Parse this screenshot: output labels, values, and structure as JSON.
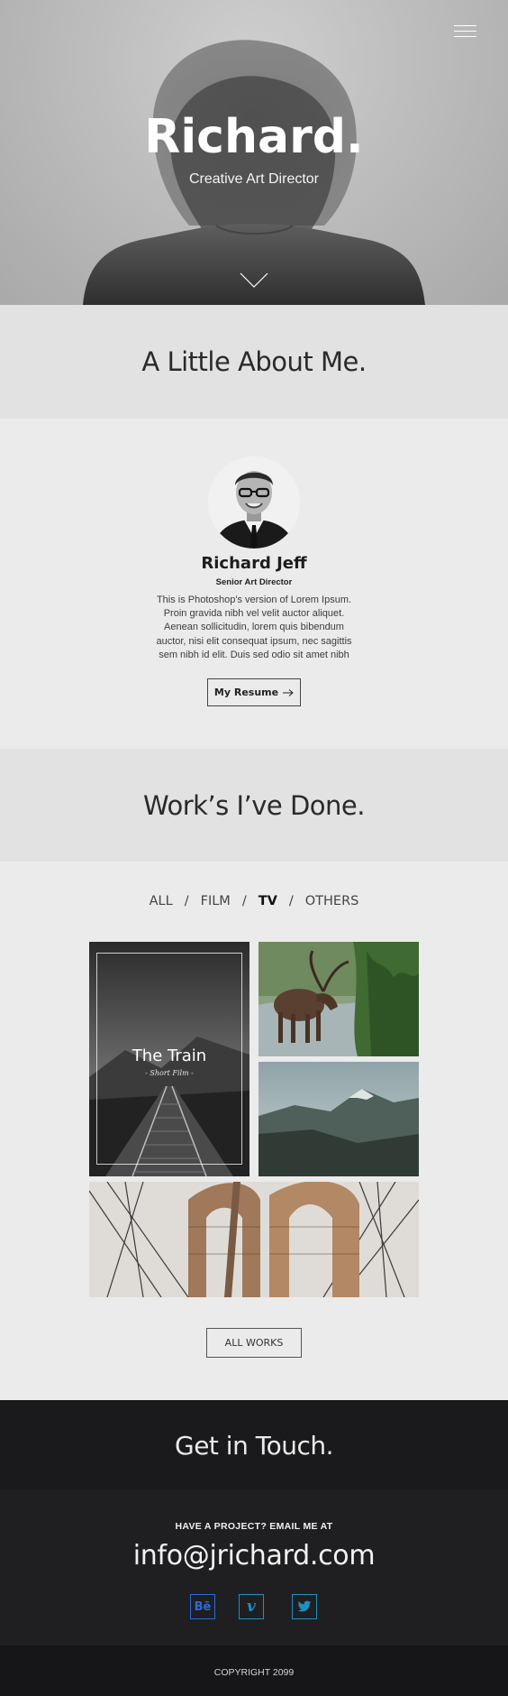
{
  "hero": {
    "title": "Richard.",
    "subtitle": "Creative Art Director"
  },
  "about": {
    "heading": "A Little About Me.",
    "name": "Richard Jeff",
    "role": "Senior Art Director",
    "bio": "This is Photoshop's version  of Lorem Ipsum. Proin gravida nibh vel velit auctor aliquet. Aenean sollicitudin, lorem quis bibendum auctor, nisi elit consequat ipsum, nec sagittis sem nibh id elit. Duis sed odio sit amet nibh",
    "resume_label": "My Resume"
  },
  "works": {
    "heading": "Work’s I’ve Done.",
    "filters": [
      "ALL",
      "FILM",
      "TV",
      "OTHERS"
    ],
    "active_filter": "TV",
    "featured_title": "The Train",
    "featured_subtitle": "- Short Film -",
    "all_works_label": "ALL WORKS"
  },
  "contact": {
    "heading": "Get in Touch.",
    "label": "HAVE A PROJECT? EMAIL ME AT",
    "email": "info@jrichard.com",
    "social": [
      {
        "name": "behance",
        "glyph": "Bē",
        "color": "#2c6bd8"
      },
      {
        "name": "vimeo",
        "glyph": "v",
        "color": "#1f8fc0"
      },
      {
        "name": "twitter",
        "glyph": "bird",
        "color": "#1f8fc0"
      }
    ]
  },
  "footer": {
    "copyright": "COPYRIGHT 2099"
  }
}
